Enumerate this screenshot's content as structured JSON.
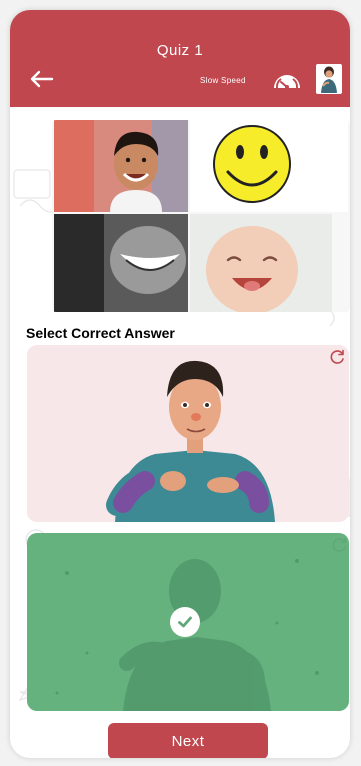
{
  "header": {
    "title": "Quiz 1",
    "speed_label": "Slow Speed",
    "icons": {
      "back": "back-arrow-icon",
      "speed": "speedometer-icon",
      "avatar": "avatar-icon"
    }
  },
  "question": {
    "text": "Select Correct Answer",
    "image": "quiz-image-collage"
  },
  "options": [
    {
      "icon": "replay-icon",
      "selected": false
    },
    {
      "icon": "replay-icon",
      "selected": true,
      "status_icon": "check-icon"
    }
  ],
  "footer": {
    "next_label": "Next"
  },
  "colors": {
    "accent": "#c0474e",
    "option_bg": "#f7e7e8",
    "correct_bg": "#66b27f"
  }
}
